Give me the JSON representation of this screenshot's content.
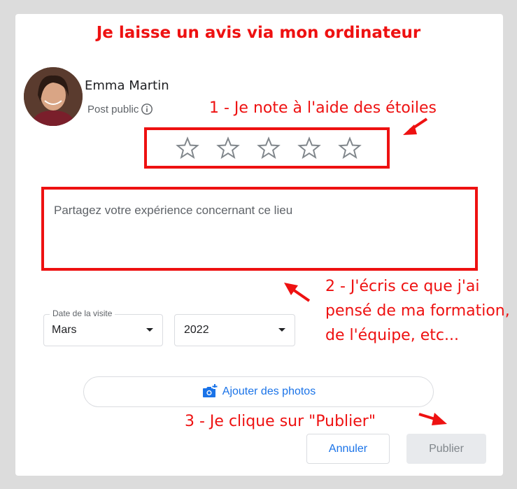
{
  "headline": "Je laisse un avis via mon ordinateur",
  "user": {
    "name": "Emma Martin",
    "visibility": "Post public"
  },
  "annotations": {
    "step1": "1 - Je note à l'aide des étoiles",
    "step2": "2 - J'écris ce que j'ai pensé de ma formation, de l'équipe, etc...",
    "step3": "3 - Je clique sur \"Publier\""
  },
  "rating": {
    "max": 5,
    "value": 0
  },
  "review": {
    "placeholder": "Partagez votre expérience concernant ce lieu",
    "value": ""
  },
  "visit": {
    "label": "Date de la visite",
    "month": "Mars",
    "year": "2022"
  },
  "buttons": {
    "add_photos": "Ajouter des photos",
    "cancel": "Annuler",
    "publish": "Publier"
  },
  "colors": {
    "annotation": "#ee1111",
    "accent": "#1a73e8",
    "disabled_bg": "#e8eaed",
    "disabled_text": "#80868b"
  },
  "icons": [
    "info-icon",
    "star-icon",
    "add-photo-icon",
    "caret-down-icon",
    "annotation-arrow-icon"
  ]
}
